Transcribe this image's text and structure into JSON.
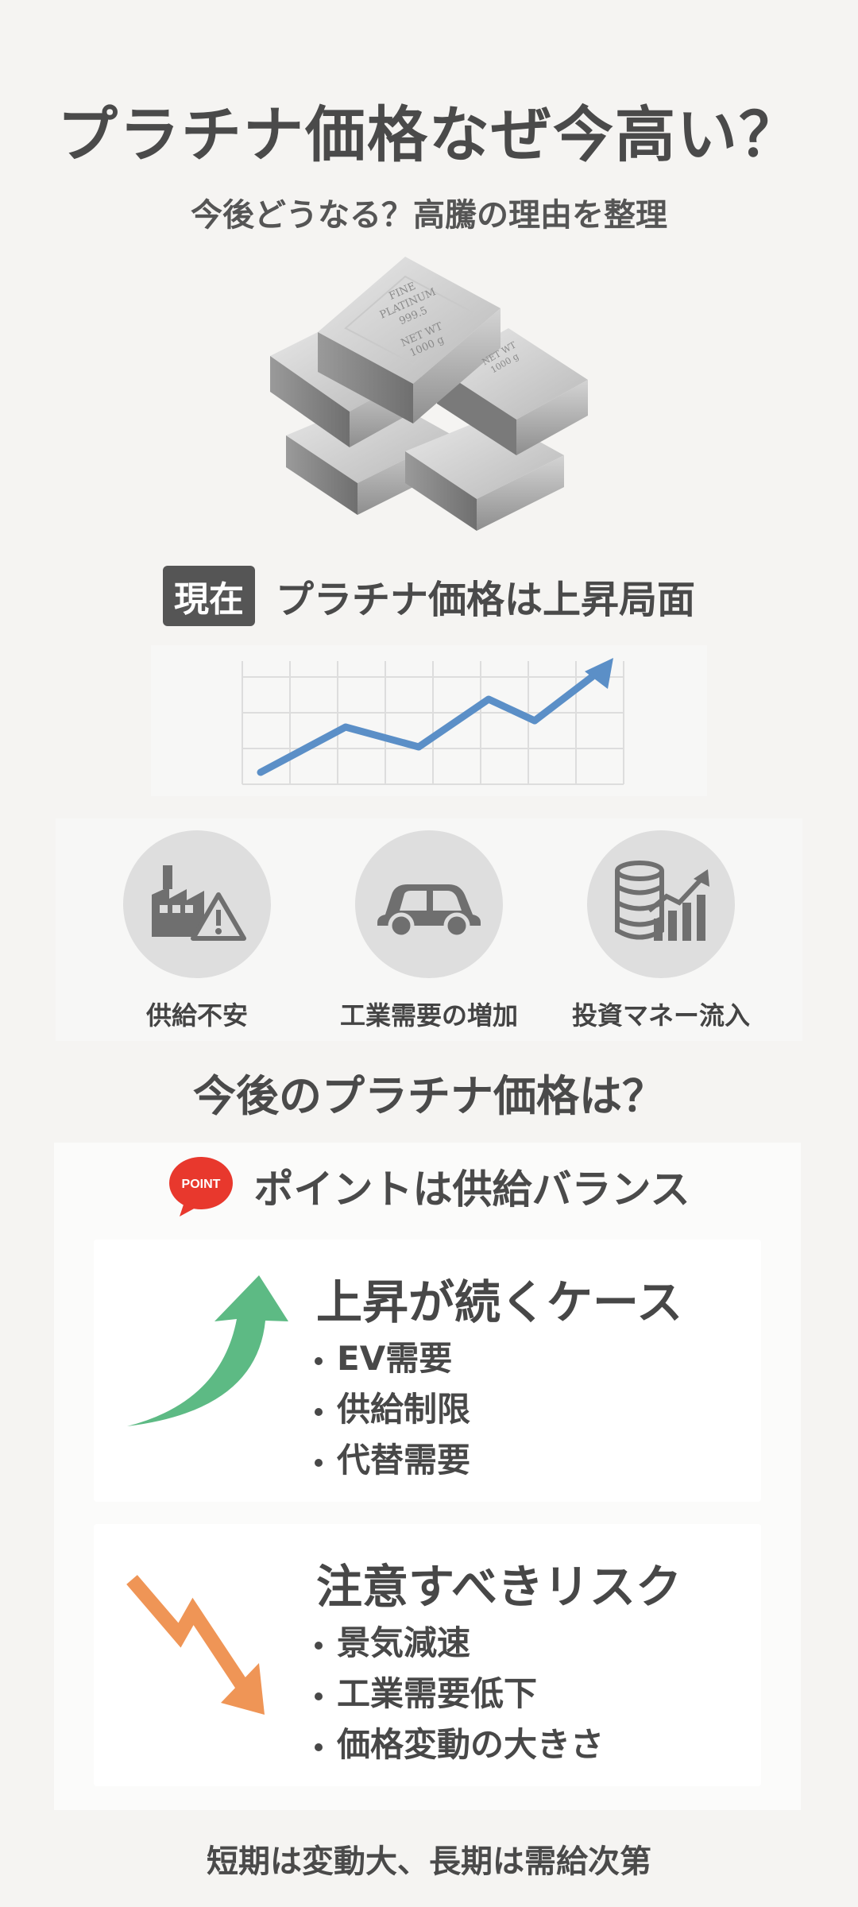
{
  "header": {
    "title": "プラチナ価格なぜ今高い？",
    "subtitle": "今後どうなる？高騰の理由を整理"
  },
  "bars_image": {
    "front_bar_lines": [
      "FINE",
      "PLATINUM",
      "999.5",
      "NET WT",
      "1000 g"
    ],
    "side_bar_lines": [
      "NET WT",
      "1000 g"
    ]
  },
  "current": {
    "badge": "現在",
    "text": "プラチナ価格は上昇局面",
    "chart_color": "#5b8fc7"
  },
  "factors": [
    {
      "label": "供給不安",
      "icon": "factory-warning-icon"
    },
    {
      "label": "工業需要の増加",
      "icon": "car-icon"
    },
    {
      "label": "投資マネー流入",
      "icon": "coins-chart-icon"
    }
  ],
  "future": {
    "heading": "今後のプラチナ価格は？",
    "point_badge": "POINT",
    "point_text": "ポイントは供給バランス",
    "up_case": {
      "title": "上昇が続くケース",
      "items": [
        "EV需要",
        "供給制限",
        "代替需要"
      ],
      "arrow_color": "#5dba84"
    },
    "risk_case": {
      "title": "注意すべきリスク",
      "items": [
        "景気減速",
        "工業需要低下",
        "価格変動の大きさ"
      ],
      "arrow_color": "#ef9556"
    }
  },
  "footer": {
    "text": "短期は変動大、長期は需給次第"
  }
}
